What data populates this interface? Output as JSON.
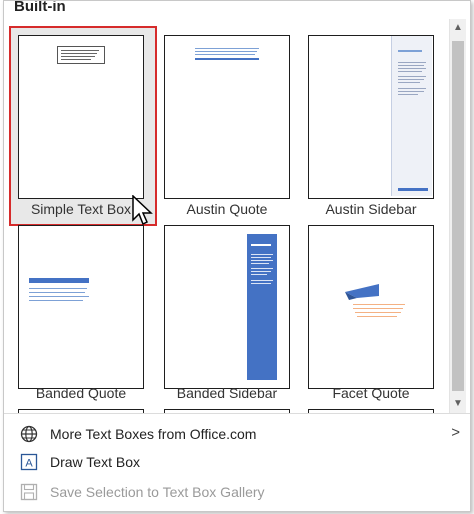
{
  "header": {
    "title": "Built-in"
  },
  "tiles": [
    {
      "label": "Simple Text Box"
    },
    {
      "label": "Austin Quote"
    },
    {
      "label": "Austin Sidebar"
    },
    {
      "label": "Banded Quote"
    },
    {
      "label": "Banded Sidebar"
    },
    {
      "label": "Facet Quote"
    }
  ],
  "menu": {
    "more": {
      "label": "More Text Boxes from Office.com",
      "icon": "globe-icon"
    },
    "draw": {
      "label": "Draw Text Box",
      "icon": "text-box-icon"
    },
    "save": {
      "label": "Save Selection to Text Box Gallery",
      "icon": "save-icon",
      "enabled": false
    }
  },
  "colors": {
    "selection": "#d62b2b",
    "accent_blue": "#4472c4",
    "orange": "#ed7d31"
  }
}
